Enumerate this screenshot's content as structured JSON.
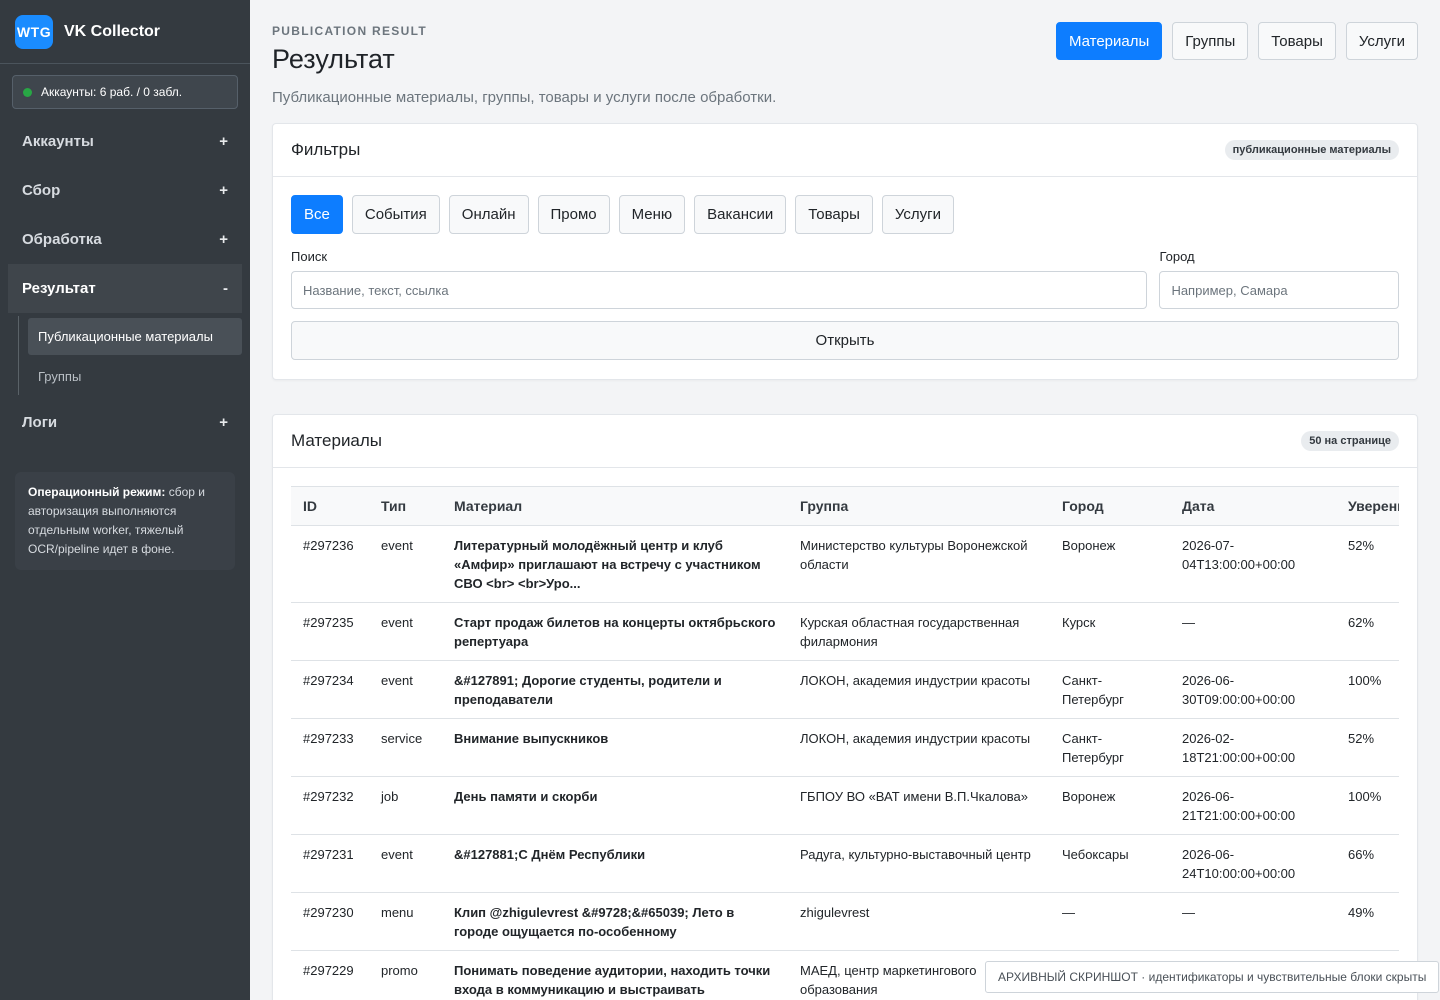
{
  "brand": {
    "logo_text": "WTG",
    "name": "VK Collector"
  },
  "accounts_status": "Аккаунты: 6 раб. / 0 забл.",
  "sidebar": {
    "items": [
      {
        "label": "Аккаунты",
        "sign": "+"
      },
      {
        "label": "Сбор",
        "sign": "+"
      },
      {
        "label": "Обработка",
        "sign": "+"
      },
      {
        "label": "Результат",
        "sign": "-"
      },
      {
        "label": "Логи",
        "sign": "+"
      }
    ],
    "sub_items": [
      {
        "label": "Публикационные материалы"
      },
      {
        "label": "Группы"
      }
    ],
    "note_bold": "Операционный режим:",
    "note_text": " сбор и авторизация выполняются отдельным worker, тяжелый OCR/pipeline идет в фоне."
  },
  "header": {
    "eyebrow": "PUBLICATION RESULT",
    "title": "Результат",
    "subtitle": "Публикационные материалы, группы, товары и услуги после обработки.",
    "buttons": [
      "Материалы",
      "Группы",
      "Товары",
      "Услуги"
    ]
  },
  "filters": {
    "title": "Фильтры",
    "badge": "публикационные материалы",
    "chips": [
      "Все",
      "События",
      "Онлайн",
      "Промо",
      "Меню",
      "Вакансии",
      "Товары",
      "Услуги"
    ],
    "search_label": "Поиск",
    "search_placeholder": "Название, текст, ссылка",
    "city_label": "Город",
    "city_placeholder": "Например, Самара",
    "open_label": "Открыть"
  },
  "materials": {
    "title": "Материалы",
    "badge": "50 на странице",
    "columns": [
      "ID",
      "Тип",
      "Материал",
      "Группа",
      "Город",
      "Дата",
      "Уверенность"
    ],
    "rows": [
      {
        "id": "#297236",
        "type": "event",
        "material": "Литературный молодёжный центр и клуб «Амфир» приглашают на встречу с участником СВО <br> <br>Уро...",
        "group": "Министерство культуры Воронежской области",
        "city": "Воронеж",
        "date": "2026-07-04T13:00:00+00:00",
        "conf": "52%"
      },
      {
        "id": "#297235",
        "type": "event",
        "material": "Старт продаж билетов на концерты октябрьского репертуара",
        "group": "Курская областная государственная филармония",
        "city": "Курск",
        "date": "—",
        "conf": "62%"
      },
      {
        "id": "#297234",
        "type": "event",
        "material": "&#127891; Дорогие студенты, родители и преподаватели",
        "group": "ЛОКОН, академия индустрии красоты",
        "city": "Санкт-Петербург",
        "date": "2026-06-30T09:00:00+00:00",
        "conf": "100%"
      },
      {
        "id": "#297233",
        "type": "service",
        "material": "Внимание выпускников",
        "group": "ЛОКОН, академия индустрии красоты",
        "city": "Санкт-Петербург",
        "date": "2026-02-18T21:00:00+00:00",
        "conf": "52%"
      },
      {
        "id": "#297232",
        "type": "job",
        "material": "День памяти и скорби",
        "group": "ГБПОУ ВО «ВАТ имени В.П.Чкалова»",
        "city": "Воронеж",
        "date": "2026-06-21T21:00:00+00:00",
        "conf": "100%"
      },
      {
        "id": "#297231",
        "type": "event",
        "material": "&#127881;С Днём Республики",
        "group": "Радуга, культурно-выставочный центр",
        "city": "Чебоксары",
        "date": "2026-06-24T10:00:00+00:00",
        "conf": "66%"
      },
      {
        "id": "#297230",
        "type": "menu",
        "material": "Клип @zhigulevrest &#9728;&#65039; Лето в городе ощущается по-особенному",
        "group": "zhigulevrest",
        "city": "—",
        "date": "—",
        "conf": "49%"
      },
      {
        "id": "#297229",
        "type": "promo",
        "material": "Понимать поведение аудитории, находить точки входа в коммуникацию и выстраивать",
        "group": "МАЕД, центр маркетингового образования",
        "city": "",
        "date": "",
        "conf": ""
      }
    ]
  },
  "watermark": "АРХИВНЫЙ СКРИНШОТ · идентификаторы и чувствительные блоки скрыты",
  "colors": {
    "primary": "#0d7dff",
    "sidebar": "#343a40",
    "status_ok": "#28a745"
  }
}
